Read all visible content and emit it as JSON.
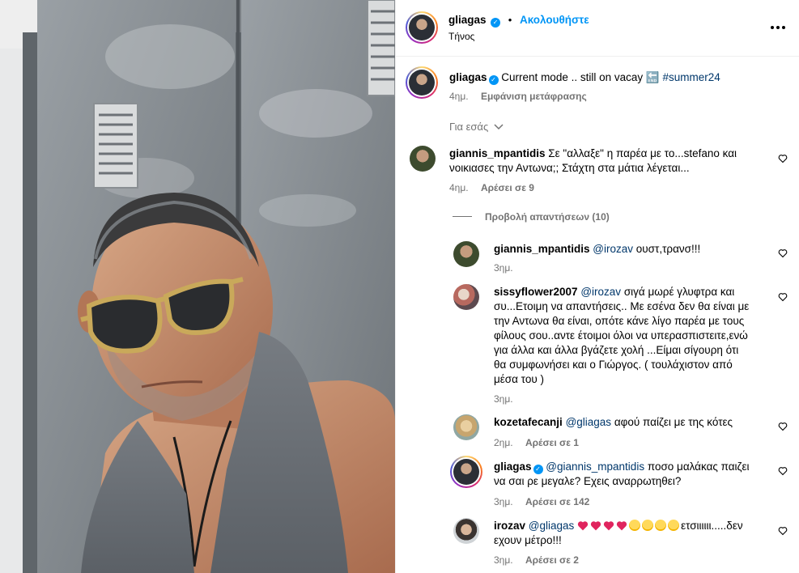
{
  "post": {
    "author": "gliagas",
    "follow_label": "Ακολουθήστε",
    "location": "Τήνος",
    "caption_author": "gliagas",
    "caption_text": "Current mode .. still on vacay 🔚",
    "caption_hashtag": "#summer24",
    "caption_time": "4ημ.",
    "see_translation": "Εμφάνιση μετάφρασης",
    "for_you": "Για εσάς"
  },
  "comments": [
    {
      "user": "giannis_mpantidis",
      "text_line1": "Σε \"αλλαξε\" η παρέα με το...stefano και",
      "text_line2": "νοικιασες την Αντωνα;; Στάχτη στα μάτια λέγεται...",
      "time": "4ημ.",
      "likes": "Αρέσει σε 9",
      "view_replies": "Προβολή απαντήσεων (10)"
    }
  ],
  "replies": [
    {
      "user": "giannis_mpantidis",
      "mention": "@irozav",
      "text": " ουστ,τρανσ!!!",
      "time": "3ημ."
    },
    {
      "user": "sissyflower2007",
      "mention": "@irozav",
      "line1": " σιγά μωρέ γλυφτρα και",
      "line2": "συ...Ετοιμη να απαντήσεις.. Με εσένα δεν θα είναι με",
      "line3": "την Αντωνα θα είναι, οπότε κάνε λίγο παρέα με τους",
      "line4": "φίλους σου..αντε έτοιμοι όλοι να υπερασπιστειτε,ενώ",
      "line5": "για άλλα και άλλα βγάζετε χολή ...Είμαι σίγουρη ότι",
      "line6": "θα συμφωνήσει και ο Γιώργος. ( τουλάχιστον από",
      "line7": "μέσα του )",
      "time": "3ημ."
    },
    {
      "user": "kozetafecanji",
      "mention": "@gliagas",
      "text": " αφού παίζει με της κότες",
      "time": "2ημ.",
      "likes": "Αρέσει σε 1"
    },
    {
      "user": "gliagas",
      "mention": "@giannis_mpantidis",
      "line1": " ποσο μαλάκας παιζει",
      "line2": "να σαι ρε μεγαλε? Εχεις αναρρωτηθει?",
      "time": "3ημ.",
      "likes": "Αρέσει σε 142"
    },
    {
      "user": "irozav",
      "mention": "@gliagas",
      "line1_tail": "ετσιιιιιι.....δεν",
      "line2": "εχουν μέτρο!!!",
      "time": "3ημ.",
      "likes": "Αρέσει σε 2"
    }
  ],
  "colors": {
    "link_blue": "#0095f6",
    "secondary_text": "#737373",
    "mention": "#00376b"
  },
  "icons": [
    "more-options-icon",
    "verified-badge-icon",
    "heart-icon",
    "chevron-down-icon",
    "end-arrow-emoji",
    "red-heart-emoji",
    "laughing-emoji"
  ]
}
